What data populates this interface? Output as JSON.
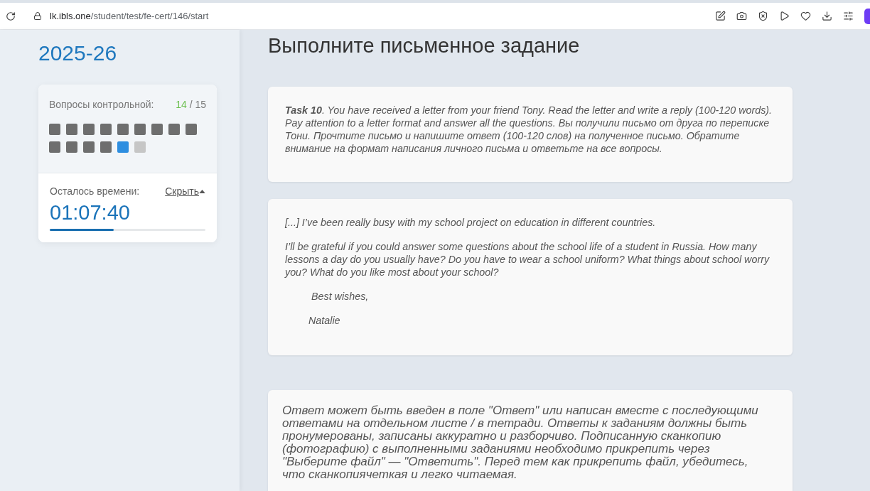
{
  "browser": {
    "address": {
      "host": "lk.ibls.one",
      "path": "/student/test/fe-cert/146/start"
    }
  },
  "sidebar": {
    "title": "2025-26",
    "questions": {
      "label": "Вопросы контрольной:",
      "done": "14",
      "total": "/ 15",
      "items": [
        {
          "answered": true,
          "selected": false
        },
        {
          "answered": true,
          "selected": false
        },
        {
          "answered": true,
          "selected": false
        },
        {
          "answered": true,
          "selected": false
        },
        {
          "answered": true,
          "selected": false
        },
        {
          "answered": true,
          "selected": false
        },
        {
          "answered": true,
          "selected": false
        },
        {
          "answered": true,
          "selected": false
        },
        {
          "answered": true,
          "selected": false
        },
        {
          "answered": true,
          "selected": false
        },
        {
          "answered": true,
          "selected": false
        },
        {
          "answered": true,
          "selected": false
        },
        {
          "answered": true,
          "selected": false
        },
        {
          "answered": false,
          "selected": true
        },
        {
          "answered": false,
          "selected": false
        }
      ]
    },
    "timer": {
      "label": "Осталось времени:",
      "hide_link": "Скрыть",
      "time": "01:07:40",
      "level": 0.41
    }
  },
  "main": {
    "heading": "Выполните письменное задание",
    "task": {
      "text": "**Task 10**. You have received a letter from your friend Tony. Read the letter and write a reply (100-120 words). Pay attention to a letter format and answer all the questions. Вы получили письмо от друга по переписке Тони. Прочтите письмо и напишите ответ (100-120 слов) на полученное письмо. Обратите внимание на формат написания личного письма и ответьте на все вопросы."
    },
    "letter": {
      "paragraphs": [
        "[...] I’ve been really busy with my school project on education in different countries.",
        "I’ll be grateful if you could answer some questions about the school life of a student in Russia. How many lessons a day do you usually have? Do you have to wear a school uniform? What things about school worry you? What do you like most about your school?"
      ],
      "closing": "Best wishes,",
      "signature": "Natalie"
    },
    "instructions": {
      "text": "Ответ может быть введен в поле \"Ответ\" или написан вместе с последующими ответами на отдельном листе / в тетради. Ответы к заданиям должны быть пронумерованы, записаны аккуратно и разборчиво. Подписанную сканкопию (фотографию) с выполненными заданиями необходимо прикрепить через \"Выберите файл\" — \"Ответить\". Перед тем как прикрепить файл, убедитесь, что сканкопиячеткая и легко читаемая."
    }
  }
}
